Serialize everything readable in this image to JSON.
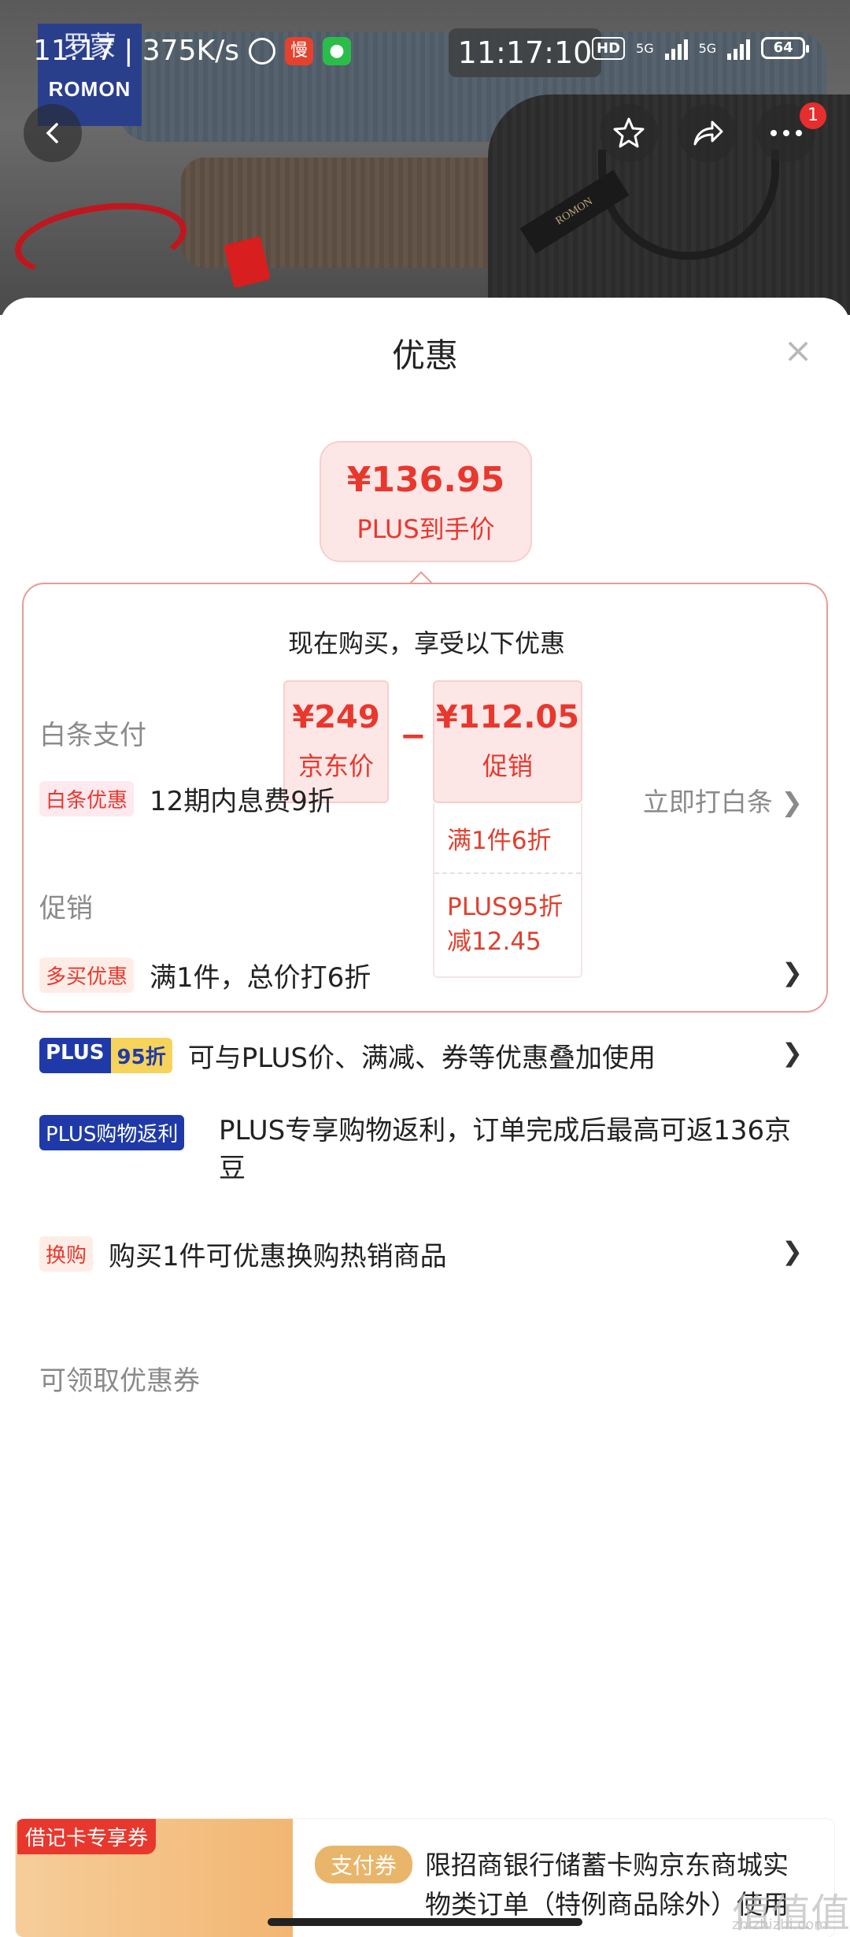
{
  "status_bar": {
    "left_text": "11:17 | 375K/s",
    "slow_icon_char": "慢",
    "center_time": "11:17:10",
    "hd_label": "HD",
    "net1": "5G",
    "net2": "5G",
    "battery": "64"
  },
  "hero": {
    "brand_cn": "罗蒙",
    "brand_en": "ROMON",
    "tag_text": "ROMON",
    "notification_count": "1"
  },
  "sheet": {
    "title": "优惠",
    "close": "×",
    "final_price": "¥136.95",
    "final_label": "PLUS到手价",
    "calc_heading": "现在购买，享受以下优惠",
    "base_price": "¥249",
    "base_label": "京东价",
    "minus": "−",
    "promo_price": "¥112.05",
    "promo_label": "促销",
    "promo_detail_1": "满1件6折",
    "promo_detail_2": "PLUS95折减12.45"
  },
  "baitiao": {
    "section_title": "白条支付",
    "tag": "白条优惠",
    "text": "12期内息费9折",
    "link": "立即打白条 ❯"
  },
  "promotion": {
    "section_title": "促销",
    "items": [
      {
        "tag": "多买优惠",
        "text": "满1件，总价打6折",
        "chevron": "❯"
      },
      {
        "tag_a": "PLUS",
        "tag_b": "95折",
        "text": "可与PLUS价、满减、券等优惠叠加使用",
        "chevron": "❯"
      },
      {
        "tag": "PLUS购物返利",
        "text": "PLUS专享购物返利，订单完成后最高可返136京豆"
      },
      {
        "tag": "换购",
        "text": "购买1件可优惠换购热销商品",
        "chevron": "❯"
      }
    ]
  },
  "coupons": {
    "section_title": "可领取优惠券",
    "flag": "借记卡专享券",
    "type": "支付券",
    "desc": "限招商银行储蓄卡购京东商城实物类订单（特例商品除外）使用"
  },
  "watermark": {
    "main": "值值值",
    "sub": "zhizhizhi.com"
  },
  "colors": {
    "accent": "#e8382e",
    "plus_blue": "#1f3aa8",
    "plus_gold": "#f6d35a"
  }
}
